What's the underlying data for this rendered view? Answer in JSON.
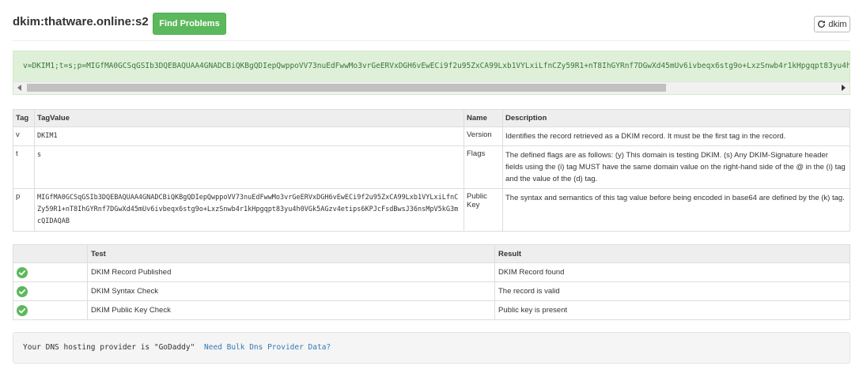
{
  "header": {
    "title": "dkim:thatware.online:s2",
    "find_label": "Find Problems",
    "dkim_label": "dkim",
    "dkim_icon": "refresh-icon"
  },
  "record": {
    "text": "v=DKIM1;t=s;p=MIGfMA0GCSqGSIb3DQEBAQUAA4GNADCBiQKBgQDIepQwppoVV73nuEdFwwMo3vrGeERVxDGH6vEwECi9f2u95ZxCA99Lxb1VYLxiLfnCZy59R1+nT8IhGYRnf7DGwXd45mUv6ivbeqx6stg9o+LxzSnwb4r1kHpgqpt83yu4h"
  },
  "tag_table": {
    "headers": [
      "Tag",
      "TagValue",
      "Name",
      "Description"
    ],
    "rows": [
      {
        "tag": "v",
        "value": "DKIM1",
        "name": "Version",
        "description": "Identifies the record retrieved as a DKIM record. It must be the first tag in the record."
      },
      {
        "tag": "t",
        "value": "s",
        "name": "Flags",
        "description": "The defined flags are as follows: (y) This domain is testing DKIM. (s) Any DKIM-Signature header fields using the (i) tag MUST have the same domain value on the right-hand side of the @ in the (i) tag and the value of the (d) tag."
      },
      {
        "tag": "p",
        "value": "MIGfMA0GCSqGSIb3DQEBAQUAA4GNADCBiQKBgQDIepQwppoVV73nuEdFwwMo3vrGeERVxDGH6vEwECi9f2u95ZxCA99Lxb1VYLxiLfnCZy59R1+nT8IhGYRnf7DGwXd45mUv6ivbeqx6stg9o+LxzSnwb4r1kHpgqpt83yu4h0VGk5AGzv4etips6KPJcFsdBwsJ36nsMpV5kG3mcQIDAQAB",
        "name": "Public Key",
        "description": "The syntax and semantics of this tag value before being encoded in base64 are defined by the (k) tag."
      }
    ]
  },
  "test_table": {
    "headers": [
      "",
      "Test",
      "Result"
    ],
    "rows": [
      {
        "status_icon": "check-circle-icon",
        "test": "DKIM Record Published",
        "result": "DKIM Record found"
      },
      {
        "status_icon": "check-circle-icon",
        "test": "DKIM Syntax Check",
        "result": "The record is valid"
      },
      {
        "status_icon": "check-circle-icon",
        "test": "DKIM Public Key Check",
        "result": "Public key is present"
      }
    ]
  },
  "dns": {
    "text": "Your DNS hosting provider is \"GoDaddy\"",
    "link": "Need Bulk Dns Provider Data?"
  },
  "colors": {
    "success": "#5cb85c",
    "record_bg": "#dff0d8",
    "record_text": "#3c763d",
    "link": "#337ab7"
  }
}
